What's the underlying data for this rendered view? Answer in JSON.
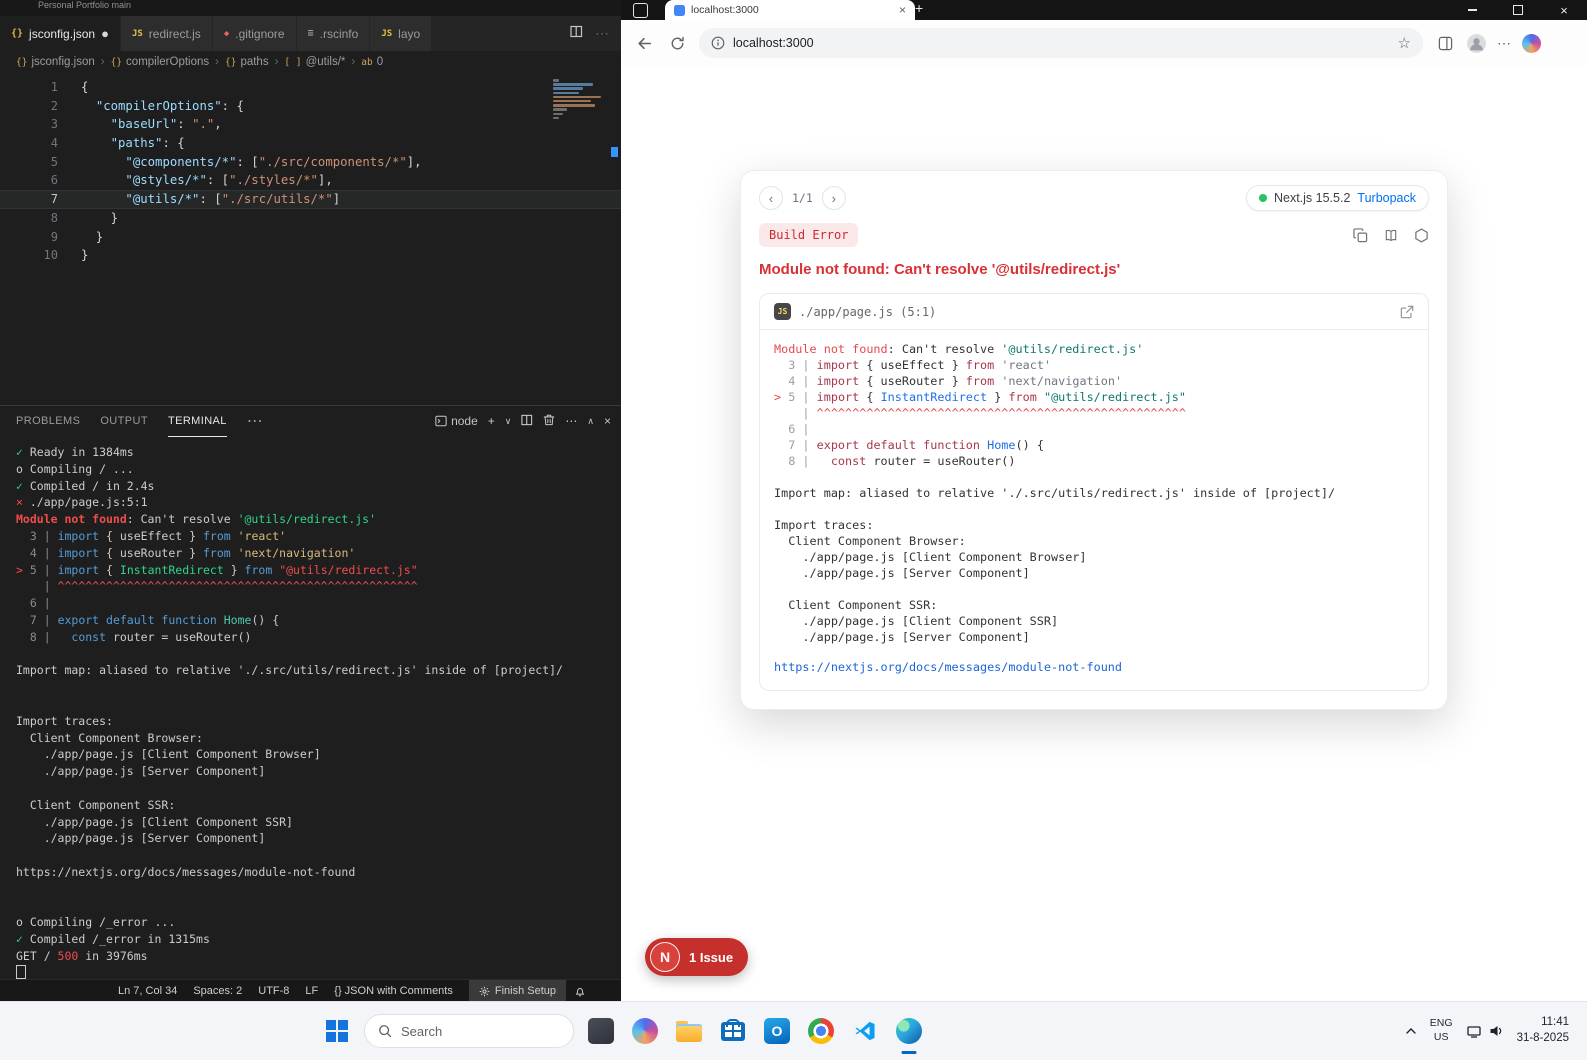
{
  "vscode": {
    "window_title": "Personal Portfolio main",
    "tabs": [
      {
        "label": "jsconfig.json",
        "icon": "json",
        "active": true,
        "modified": true
      },
      {
        "label": "redirect.js",
        "icon": "js",
        "active": false,
        "modified": false
      },
      {
        "label": ".gitignore",
        "icon": "gitignore",
        "active": false,
        "modified": false
      },
      {
        "label": ".rscinfo",
        "icon": "rscinfo",
        "active": false,
        "modified": false
      },
      {
        "label": "layo",
        "icon": "js",
        "active": false,
        "modified": false
      }
    ],
    "breadcrumbs": [
      {
        "label": "jsconfig.json",
        "icon": "{}"
      },
      {
        "label": "compilerOptions",
        "icon": "{}"
      },
      {
        "label": "paths",
        "icon": "{}"
      },
      {
        "label": "@utils/*",
        "icon": "[ ]"
      },
      {
        "label": "0",
        "icon": "ab"
      }
    ],
    "editor_lines": [
      {
        "n": "1",
        "current": false,
        "t": [
          [
            "p",
            "{"
          ]
        ]
      },
      {
        "n": "2",
        "current": false,
        "t": [
          [
            "p",
            "  "
          ],
          [
            "k",
            "\"compilerOptions\""
          ],
          [
            "p",
            ": {"
          ]
        ]
      },
      {
        "n": "3",
        "current": false,
        "t": [
          [
            "p",
            "    "
          ],
          [
            "k",
            "\"baseUrl\""
          ],
          [
            "p",
            ": "
          ],
          [
            "s",
            "\".\""
          ],
          [
            "p",
            ","
          ]
        ]
      },
      {
        "n": "4",
        "current": false,
        "t": [
          [
            "p",
            "    "
          ],
          [
            "k",
            "\"paths\""
          ],
          [
            "p",
            ": {"
          ]
        ]
      },
      {
        "n": "5",
        "current": false,
        "t": [
          [
            "p",
            "      "
          ],
          [
            "k",
            "\"@components/*\""
          ],
          [
            "p",
            ": ["
          ],
          [
            "s",
            "\"./src/components/*\""
          ],
          [
            "p",
            "],"
          ]
        ]
      },
      {
        "n": "6",
        "current": false,
        "t": [
          [
            "p",
            "      "
          ],
          [
            "k",
            "\"@styles/*\""
          ],
          [
            "p",
            ": ["
          ],
          [
            "s",
            "\"./styles/*\""
          ],
          [
            "p",
            "],"
          ]
        ]
      },
      {
        "n": "7",
        "current": true,
        "t": [
          [
            "p",
            "      "
          ],
          [
            "k",
            "\"@utils/*\""
          ],
          [
            "p",
            ": ["
          ],
          [
            "s",
            "\"./src/utils/*\""
          ],
          [
            "p",
            "]"
          ]
        ]
      },
      {
        "n": "8",
        "current": false,
        "t": [
          [
            "p",
            "    }"
          ]
        ]
      },
      {
        "n": "9",
        "current": false,
        "t": [
          [
            "p",
            "  }"
          ]
        ]
      },
      {
        "n": "10",
        "current": false,
        "t": [
          [
            "p",
            "}"
          ]
        ]
      }
    ],
    "panel_tabs": [
      {
        "label": "PROBLEMS",
        "active": false
      },
      {
        "label": "OUTPUT",
        "active": false
      },
      {
        "label": "TERMINAL",
        "active": true
      }
    ],
    "shell_label": "node",
    "terminal_lines": [
      [
        [
          "g",
          "✓"
        ],
        [
          "w",
          " Ready in 1384ms"
        ]
      ],
      [
        [
          "w",
          "o Compiling / ..."
        ]
      ],
      [
        [
          "g",
          "✓"
        ],
        [
          "w",
          " Compiled / in 2.4s"
        ]
      ],
      [
        [
          "r",
          "×"
        ],
        [
          "w",
          " ./app/page.js:5:1"
        ]
      ],
      [
        [
          "rb",
          "Module not found"
        ],
        [
          "w",
          ": Can't resolve "
        ],
        [
          "g",
          "'@utils/redirect.js'"
        ]
      ],
      [
        [
          "gr",
          "  3 |"
        ],
        [
          "w",
          " "
        ],
        [
          "b",
          "import"
        ],
        [
          "w",
          " { useEffect } "
        ],
        [
          "b",
          "from"
        ],
        [
          "w",
          " "
        ],
        [
          "y",
          "'react'"
        ]
      ],
      [
        [
          "gr",
          "  4 |"
        ],
        [
          "w",
          " "
        ],
        [
          "b",
          "import"
        ],
        [
          "w",
          " { useRouter } "
        ],
        [
          "b",
          "from"
        ],
        [
          "w",
          " "
        ],
        [
          "y",
          "'next/navigation'"
        ]
      ],
      [
        [
          "r",
          "> "
        ],
        [
          "gr",
          "5 |"
        ],
        [
          "w",
          " "
        ],
        [
          "b",
          "import"
        ],
        [
          "w",
          " { "
        ],
        [
          "g",
          "InstantRedirect"
        ],
        [
          "w",
          " } "
        ],
        [
          "b",
          "from"
        ],
        [
          "w",
          " "
        ],
        [
          "r",
          "\"@utils/redirect.js\""
        ]
      ],
      [
        [
          "gr",
          "    | "
        ],
        [
          "r",
          "^^^^^^^^^^^^^^^^^^^^^^^^^^^^^^^^^^^^^^^^^^^^^^^^^^^^"
        ]
      ],
      [
        [
          "gr",
          "  6 |"
        ]
      ],
      [
        [
          "gr",
          "  7 |"
        ],
        [
          "w",
          " "
        ],
        [
          "b",
          "export default function"
        ],
        [
          "w",
          " "
        ],
        [
          "tl",
          "Home"
        ],
        [
          "w",
          "() {"
        ]
      ],
      [
        [
          "gr",
          "  8 |"
        ],
        [
          "w",
          "   "
        ],
        [
          "b",
          "const"
        ],
        [
          "w",
          " router = useRouter()"
        ]
      ],
      [],
      [
        [
          "w",
          "Import map: aliased to relative './.src/utils/redirect.js' inside of [project]/"
        ]
      ],
      [],
      [],
      [
        [
          "w",
          "Import traces:"
        ]
      ],
      [
        [
          "w",
          "  Client Component Browser:"
        ]
      ],
      [
        [
          "w",
          "    ./app/page.js [Client Component Browser]"
        ]
      ],
      [
        [
          "w",
          "    ./app/page.js [Server Component]"
        ]
      ],
      [],
      [
        [
          "w",
          "  Client Component SSR:"
        ]
      ],
      [
        [
          "w",
          "    ./app/page.js [Client Component SSR]"
        ]
      ],
      [
        [
          "w",
          "    ./app/page.js [Server Component]"
        ]
      ],
      [],
      [
        [
          "w",
          "https://nextjs.org/docs/messages/module-not-found"
        ]
      ],
      [],
      [],
      [
        [
          "w",
          "o Compiling /_error ..."
        ]
      ],
      [
        [
          "g",
          "✓"
        ],
        [
          "w",
          " Compiled /_error in 1315ms"
        ]
      ],
      [
        [
          "w",
          "GET / "
        ],
        [
          "r",
          "500"
        ],
        [
          "w",
          " in 3976ms"
        ]
      ],
      [
        [
          "cur",
          ""
        ]
      ]
    ],
    "status_items": [
      "Ln 7, Col 34",
      "Spaces: 2",
      "UTF-8",
      "LF",
      "{} JSON with Comments"
    ],
    "status_setup": "Finish Setup"
  },
  "browser": {
    "tab_title": "localhost:3000",
    "url": "localhost:3000",
    "new_tab": "+",
    "overlay": {
      "prev": "‹",
      "next": "›",
      "pagination": "1/1",
      "version": "Next.js 15.5.2",
      "bundler": "Turbopack",
      "badge": "Build Error",
      "title": "Module not found: Can't resolve '@utils/redirect.js'",
      "file": "./app/page.js (5:1)",
      "js_badge": "JS",
      "frame_lines": [
        [
          [
            "red",
            "Module not found"
          ],
          [
            "d",
            ": Can't resolve "
          ],
          [
            "sq",
            "'@utils/redirect.js'"
          ]
        ],
        [
          [
            "dim",
            "  3 |"
          ],
          [
            "d",
            " "
          ],
          [
            "kw",
            "import"
          ],
          [
            "d",
            " { useEffect } "
          ],
          [
            "kw",
            "from"
          ],
          [
            "d",
            " "
          ],
          [
            "st",
            "'react'"
          ]
        ],
        [
          [
            "dim",
            "  4 |"
          ],
          [
            "d",
            " "
          ],
          [
            "kw",
            "import"
          ],
          [
            "d",
            " { useRouter } "
          ],
          [
            "kw",
            "from"
          ],
          [
            "d",
            " "
          ],
          [
            "st",
            "'next/navigation'"
          ]
        ],
        [
          [
            "red",
            "> "
          ],
          [
            "dim",
            "5 |"
          ],
          [
            "d",
            " "
          ],
          [
            "kw",
            "import"
          ],
          [
            "d",
            " { "
          ],
          [
            "id",
            "InstantRedirect"
          ],
          [
            "d",
            " } "
          ],
          [
            "kw",
            "from"
          ],
          [
            "d",
            " "
          ],
          [
            "sq",
            "\"@utils/redirect.js\""
          ]
        ],
        [
          [
            "dim",
            "    | "
          ],
          [
            "red",
            "^^^^^^^^^^^^^^^^^^^^^^^^^^^^^^^^^^^^^^^^^^^^^^^^^^^^"
          ]
        ],
        [
          [
            "dim",
            "  6 |"
          ]
        ],
        [
          [
            "dim",
            "  7 |"
          ],
          [
            "d",
            " "
          ],
          [
            "kw",
            "export default function"
          ],
          [
            "d",
            " "
          ],
          [
            "id",
            "Home"
          ],
          [
            "d",
            "() {"
          ]
        ],
        [
          [
            "dim",
            "  8 |"
          ],
          [
            "d",
            "   "
          ],
          [
            "kw",
            "const"
          ],
          [
            "d",
            " router = useRouter()"
          ]
        ],
        [],
        [
          [
            "d",
            "Import map: aliased to relative './.src/utils/redirect.js' inside of [project]/"
          ]
        ],
        [],
        [
          [
            "d",
            "Import traces:"
          ]
        ],
        [
          [
            "d",
            "  Client Component Browser:"
          ]
        ],
        [
          [
            "d",
            "    ./app/page.js [Client Component Browser]"
          ]
        ],
        [
          [
            "d",
            "    ./app/page.js [Server Component]"
          ]
        ],
        [],
        [
          [
            "d",
            "  Client Component SSR:"
          ]
        ],
        [
          [
            "d",
            "    ./app/page.js [Client Component SSR]"
          ]
        ],
        [
          [
            "d",
            "    ./app/page.js [Server Component]"
          ]
        ]
      ],
      "link": "https://nextjs.org/docs/messages/module-not-found"
    },
    "issue_logo": "N",
    "issue_label": "1 Issue"
  },
  "taskbar": {
    "search_label": "Search",
    "lang_line1": "ENG",
    "lang_line2": "US",
    "time": "11:41",
    "date": "31-8-2025"
  }
}
